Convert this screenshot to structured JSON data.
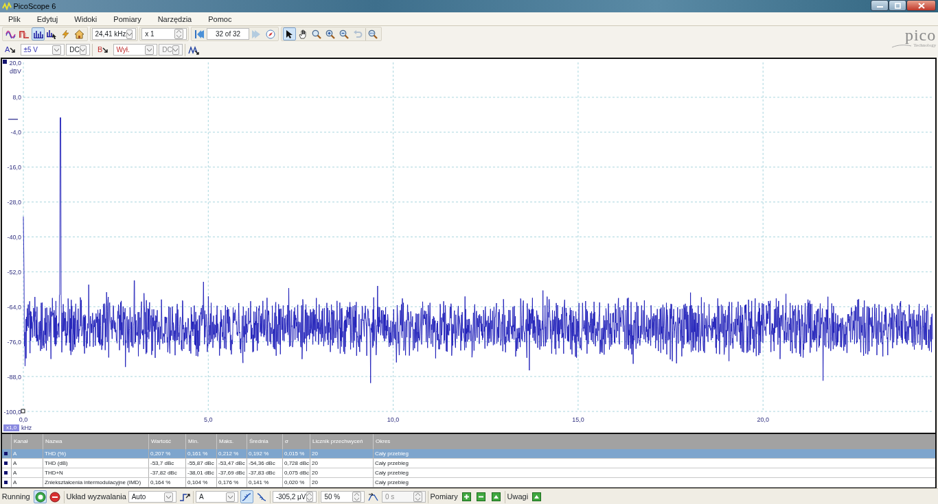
{
  "window": {
    "title": "PicoScope 6"
  },
  "logo": {
    "name": "pico",
    "tagline": "Technology"
  },
  "menu": [
    "Plik",
    "Edytuj",
    "Widoki",
    "Pomiary",
    "Narzędzia",
    "Pomoc"
  ],
  "toolbar": {
    "mode_buttons": [
      {
        "kind": "scope",
        "selected": false
      },
      {
        "kind": "persistence",
        "selected": false
      },
      {
        "kind": "spectrum",
        "selected": true
      },
      {
        "kind": "spectrum-cursor",
        "selected": false
      }
    ],
    "timebase": "24,41 kHz",
    "zoom": "x 1",
    "buffer": "32 of 32",
    "nav_buttons": [
      {
        "kind": "first",
        "disabled": false
      },
      {
        "kind": "next",
        "disabled": true
      }
    ],
    "tools": [
      {
        "kind": "pointer",
        "selected": true,
        "disabled": false
      },
      {
        "kind": "hand",
        "selected": false,
        "disabled": false
      },
      {
        "kind": "zoom-area",
        "selected": false,
        "disabled": false
      },
      {
        "kind": "zoom-in",
        "selected": false,
        "disabled": false
      },
      {
        "kind": "zoom-out",
        "selected": false,
        "disabled": false
      },
      {
        "kind": "undo",
        "selected": false,
        "disabled": true
      },
      {
        "kind": "zoom-fit",
        "selected": false,
        "disabled": false
      }
    ]
  },
  "channels": [
    {
      "label": "A",
      "range": "±5 V",
      "coupling": "DC",
      "coupling_disabled": false,
      "color": "#3030b0"
    },
    {
      "label": "B",
      "range": "Wył.",
      "coupling": "DC",
      "coupling_disabled": true,
      "color": "#c03030"
    }
  ],
  "plot": {
    "y_unit": "dBV",
    "yticks": [
      "20,0",
      "8,0",
      "-4,0",
      "-16,0",
      "-28,0",
      "-40,0",
      "-52,0",
      "-64,0",
      "-76,0",
      "-88,0",
      "-100,0"
    ],
    "xticks": [
      "0,0",
      "5,0",
      "10,0",
      "15,0",
      "20,0"
    ],
    "x_unit": "kHz",
    "x_scale": "x1,0"
  },
  "table": {
    "columns": [
      "Kanał",
      "Nazwa",
      "Wartość",
      "Min.",
      "Maks.",
      "Średnia",
      "σ",
      "Licznik przechwyceń",
      "Okres"
    ],
    "rows": [
      {
        "selected": true,
        "cells": [
          "A",
          "THD (%)",
          "0,207 %",
          "0,161 %",
          "0,212 %",
          "0,192 %",
          "0,015 %",
          "20",
          "Cały przebieg"
        ]
      },
      {
        "selected": false,
        "cells": [
          "A",
          "THD (dB)",
          "-53,7 dBc",
          "-55,87 dBc",
          "-53,47 dBc",
          "-54,36 dBc",
          "0,728 dBc",
          "20",
          "Cały przebieg"
        ]
      },
      {
        "selected": false,
        "cells": [
          "A",
          "THD+N",
          "-37,82 dBc",
          "-38,01 dBc",
          "-37,69 dBc",
          "-37,83 dBc",
          "0,075 dBc",
          "20",
          "Cały przebieg"
        ]
      },
      {
        "selected": false,
        "cells": [
          "A",
          "Zniekształcenia intermodulacyjne (IMD)",
          "0,164 %",
          "0,104 %",
          "0,176 %",
          "0,141 %",
          "0,020 %",
          "20",
          "Cały przebieg"
        ]
      }
    ]
  },
  "status": {
    "state": "Running",
    "trigger_label": "Układ wyzwalania",
    "trigger_mode": "Auto",
    "trigger_channel": "A",
    "threshold": "-305,2 µV",
    "pretrigger": "50 %",
    "delay": "0 s",
    "delay_disabled": true,
    "measurements_label": "Pomiary",
    "notes_label": "Uwagi"
  }
}
